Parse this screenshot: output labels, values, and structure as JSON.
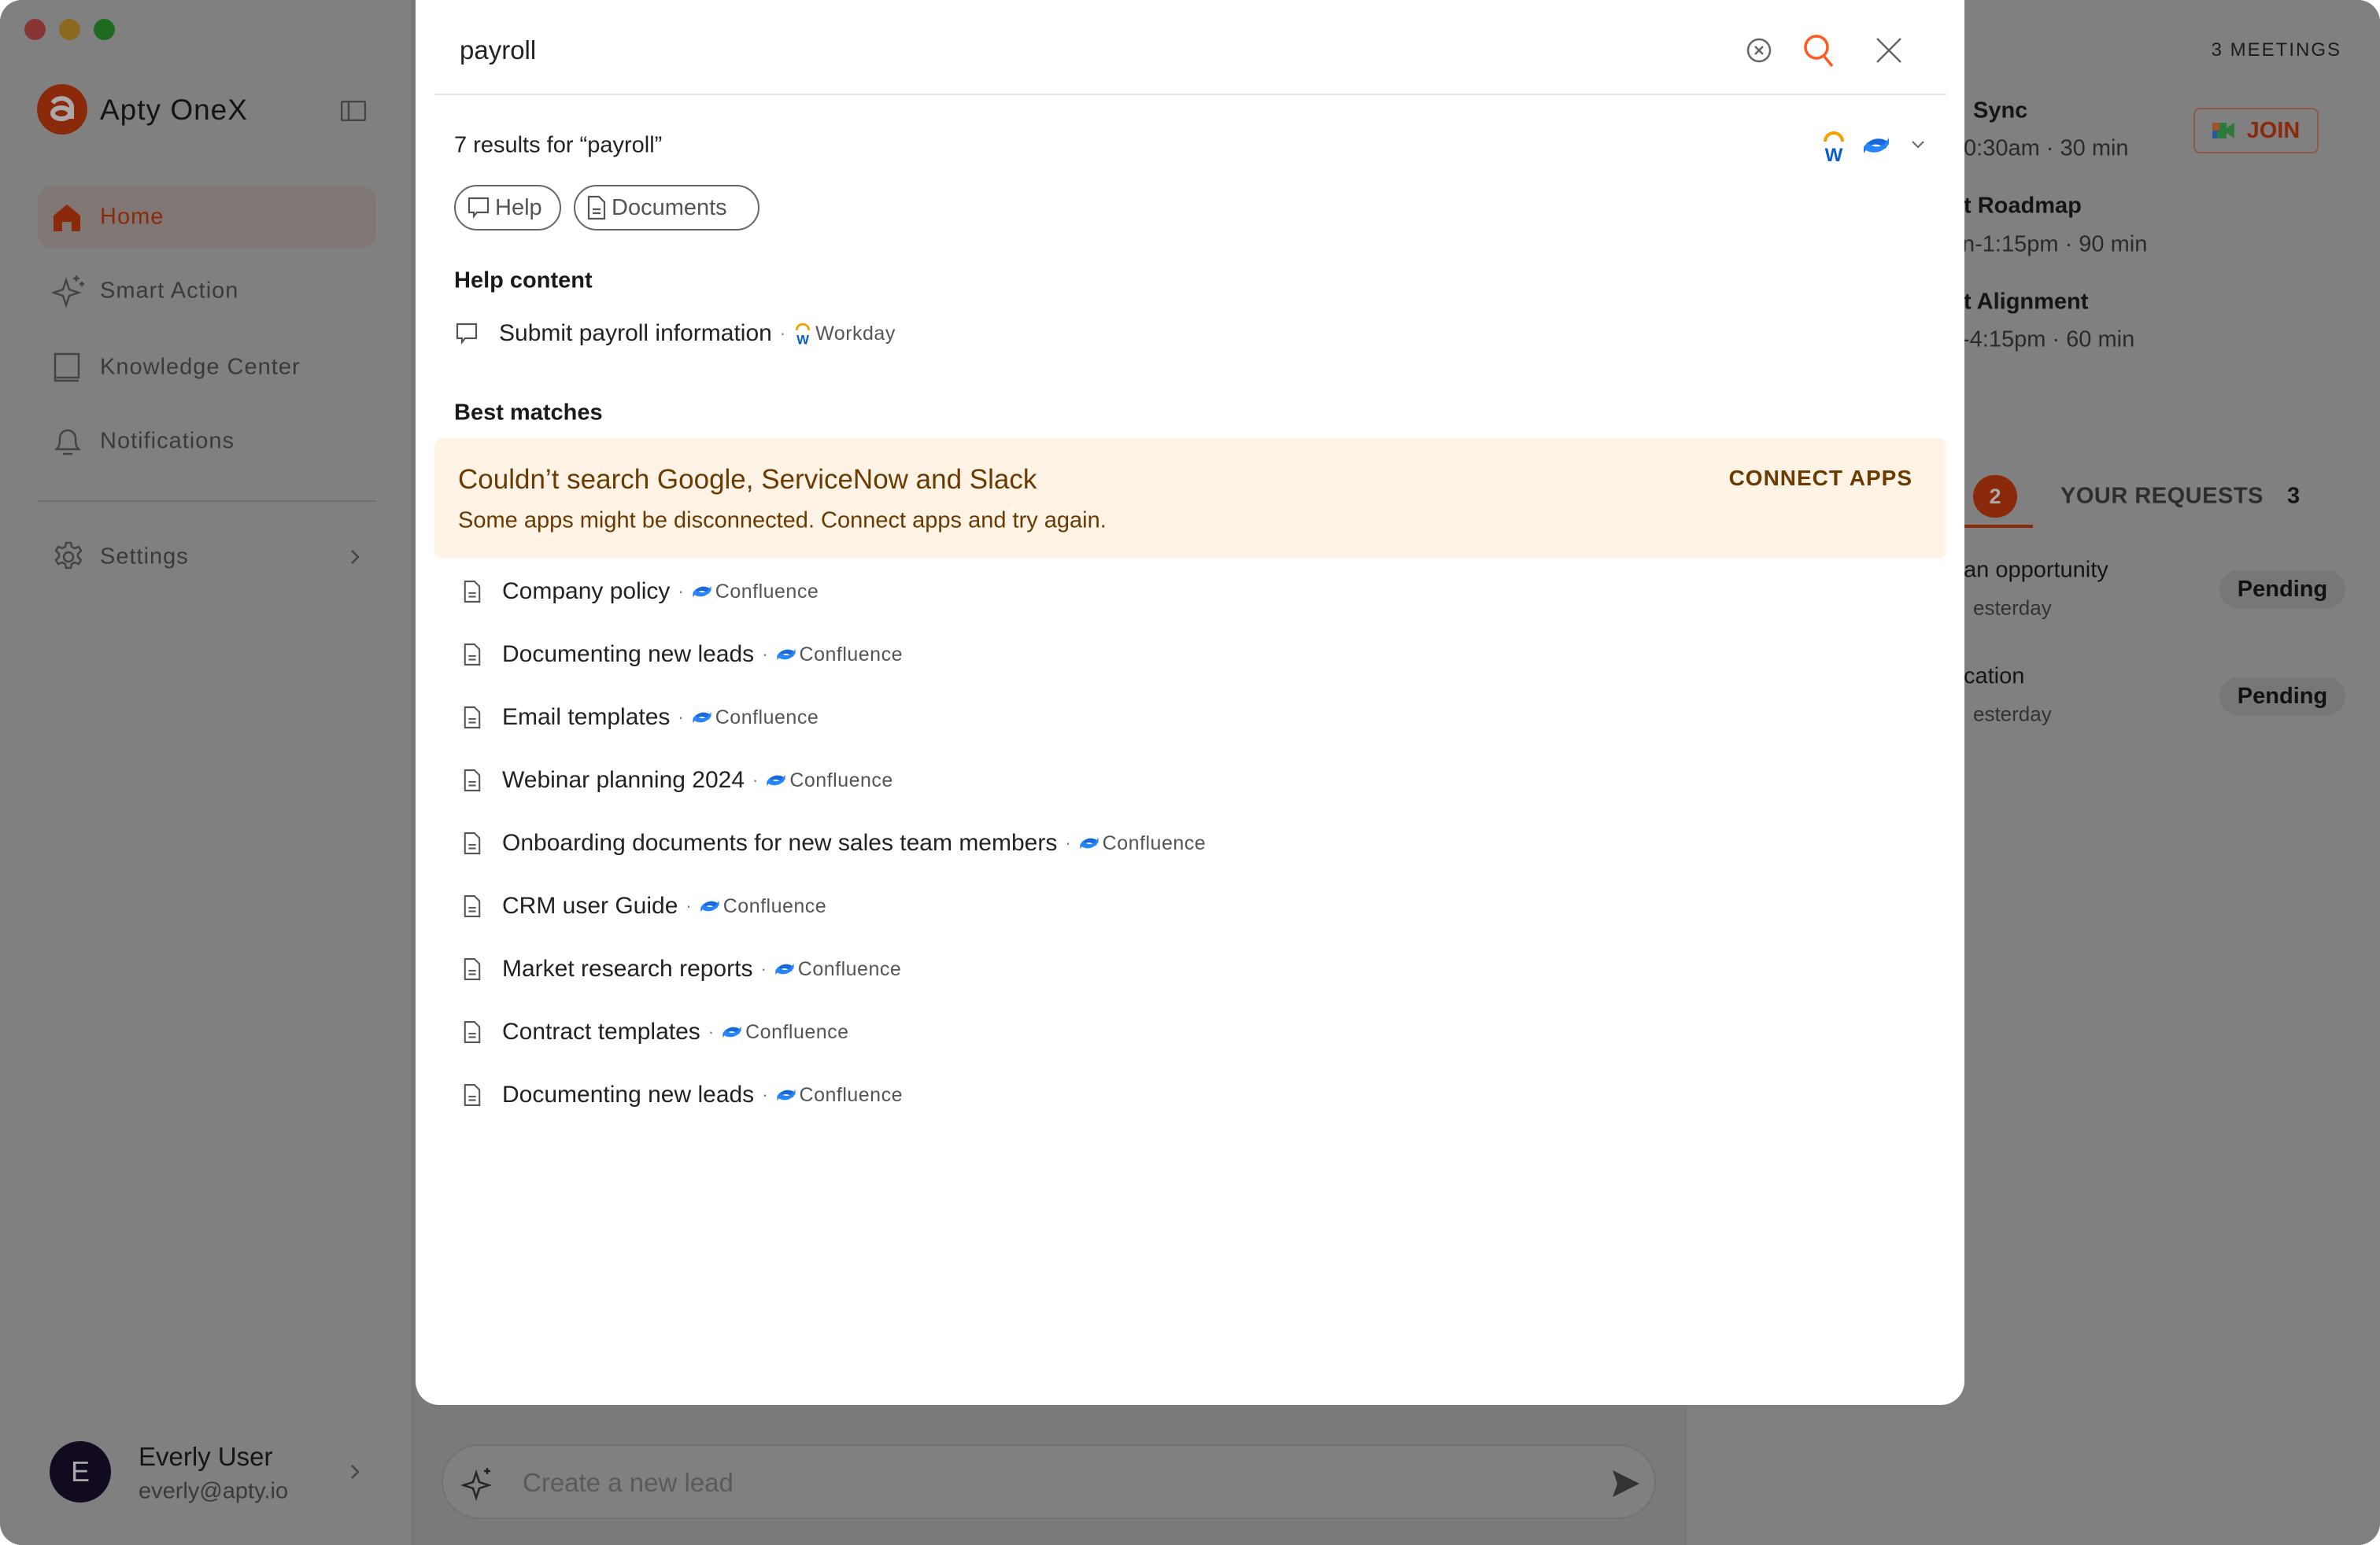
{
  "app": {
    "name": "Apty OneX"
  },
  "sidebar": {
    "items": [
      {
        "label": "Home",
        "icon": "home-icon",
        "active": true
      },
      {
        "label": "Smart Action",
        "icon": "sparkle-icon"
      },
      {
        "label": "Knowledge Center",
        "icon": "book-icon"
      },
      {
        "label": "Notifications",
        "icon": "bell-icon"
      }
    ],
    "settings": {
      "label": "Settings",
      "icon": "gear-icon"
    },
    "user": {
      "initial": "E",
      "name": "Everly User",
      "email": "everly@apty.io"
    }
  },
  "composer": {
    "placeholder": "Create a new lead"
  },
  "right_panel": {
    "meetings_count": "3 MEETINGS",
    "join_label": "JOIN",
    "meetings": [
      {
        "title": "Sync",
        "time": "0:30am · 30 min"
      },
      {
        "title": "t Roadmap",
        "time": "n-1:15pm · 90 min"
      },
      {
        "title": "t Alignment",
        "time": "-4:15pm · 60 min"
      }
    ],
    "tabs": {
      "first_badge": "2",
      "second_label": "YOUR REQUESTS",
      "second_count": "3"
    },
    "requests": [
      {
        "title": "an opportunity",
        "date": "esterday",
        "status": "Pending"
      },
      {
        "title": "cation",
        "date": "esterday",
        "status": "Pending"
      }
    ]
  },
  "search": {
    "query": "payroll",
    "results_summary": "7 results for “payroll”",
    "filters": [
      {
        "label": "Help",
        "icon": "chat-icon"
      },
      {
        "label": "Documents",
        "icon": "document-icon"
      }
    ],
    "help_heading": "Help content",
    "help_items": [
      {
        "title": "Submit payroll information",
        "source": "Workday"
      }
    ],
    "best_heading": "Best matches",
    "banner": {
      "title": "Couldn’t search Google, ServiceNow and Slack",
      "message": "Some apps might be disconnected. Connect apps and try again.",
      "action": "CONNECT APPS"
    },
    "results": [
      {
        "title": "Company policy",
        "source": "Confluence"
      },
      {
        "title": "Documenting new leads",
        "source": "Confluence"
      },
      {
        "title": "Email templates",
        "source": "Confluence"
      },
      {
        "title": "Webinar planning 2024",
        "source": "Confluence"
      },
      {
        "title": "Onboarding documents for new sales team members",
        "source": "Confluence"
      },
      {
        "title": "CRM user Guide",
        "source": "Confluence"
      },
      {
        "title": "Market research reports",
        "source": "Confluence"
      },
      {
        "title": "Contract templates",
        "source": "Confluence"
      },
      {
        "title": "Documenting new leads",
        "source": "Confluence"
      }
    ]
  },
  "colors": {
    "accent": "#FF5A1F",
    "brand": "#8A2A0A",
    "banner_bg": "#FFF3E6",
    "banner_text": "#6B3A00",
    "confluence": "#1868DB",
    "workday_blue": "#0A5FC7",
    "workday_orange": "#F5A000"
  }
}
